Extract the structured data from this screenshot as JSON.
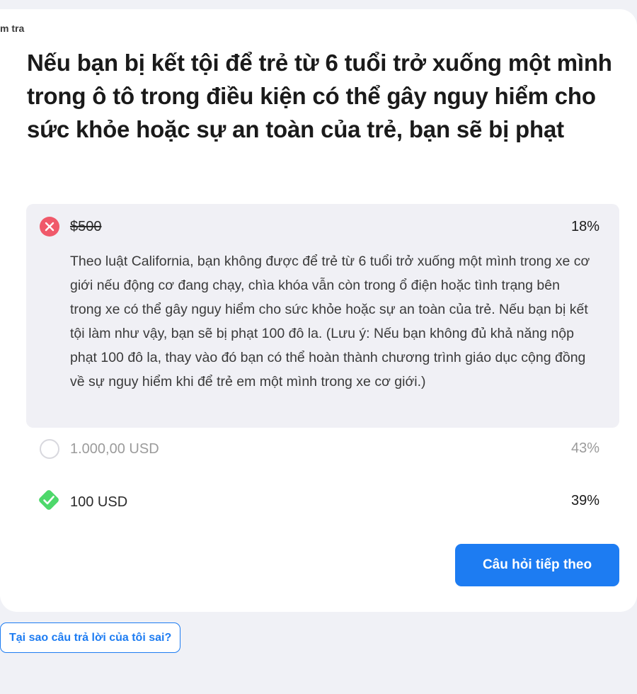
{
  "breadcrumb": "m tra",
  "question": "Nếu bạn bị kết tội để trẻ từ 6 tuổi trở xuống một mình trong ô tô trong điều kiện có thể gây nguy hiểm cho sức khỏe hoặc sự an toàn của trẻ, bạn sẽ bị phạt",
  "answers": [
    {
      "label": "$500",
      "percent": "18%",
      "status": "selected-wrong",
      "icon": "x-circle-icon",
      "explanation": "Theo luật California, bạn không được để trẻ từ 6 tuổi trở xuống một mình trong xe cơ giới nếu động cơ đang chạy, chìa khóa vẫn còn trong ổ điện hoặc tình trạng bên trong xe có thể gây nguy hiểm cho sức khỏe hoặc sự an toàn của trẻ. Nếu bạn bị kết tội làm như vậy, bạn sẽ bị phạt 100 đô la. (Lưu ý: Nếu bạn không đủ khả năng nộp phạt 100 đô la, thay vào đó bạn có thể hoàn thành chương trình giáo dục cộng đồng về sự nguy hiểm khi để trẻ em một mình trong xe cơ giới.)"
    },
    {
      "label": "1.000,00 USD",
      "percent": "43%",
      "status": "unselected",
      "icon": "empty-radio-icon"
    },
    {
      "label": "100 USD",
      "percent": "39%",
      "status": "correct",
      "icon": "check-diamond-icon"
    }
  ],
  "buttons": {
    "next": "Câu hỏi tiếp theo",
    "why_wrong": "Tại sao câu trả lời của tôi sai?"
  },
  "colors": {
    "accent": "#1d7cf2",
    "wrong": "#f0596a",
    "correct": "#4ed86b",
    "page_background": "#f0f1f6"
  }
}
